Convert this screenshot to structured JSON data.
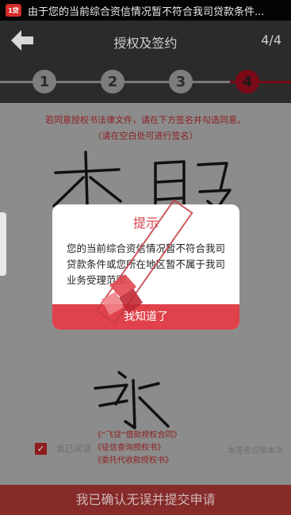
{
  "status_bar": {
    "app_badge": "1贷",
    "notification": "由于您的当前综合资信情况暂不符合我司贷款条件..."
  },
  "header": {
    "back_icon": "arrow-left-icon",
    "title": "授权及签约",
    "step_count": "4/4"
  },
  "stepper": {
    "steps": [
      "1",
      "2",
      "3",
      "4"
    ],
    "active_index": 3
  },
  "content": {
    "notice_line1": "若同意授权书法律文件，请在下方签名并勾选同意。",
    "notice_line2": "（请在空白处可进行签名）",
    "agree_label": "我已阅读",
    "agree_side": "本签名仅限本次",
    "doc_links": [
      "《“飞贷”借款授权合同》",
      "《征信查询授权书》",
      "《委托代收款授权书》"
    ]
  },
  "dialog": {
    "title": "提示",
    "body": "您的当前综合资信情况暂不符合我司贷款条件或您所在地区暂不属于我司业务受理范围。",
    "button": "我知道了"
  },
  "submit": {
    "label": "我已确认无误并提交申请"
  },
  "colors": {
    "accent": "#e0414a",
    "dark_red": "#8e1d1d"
  }
}
